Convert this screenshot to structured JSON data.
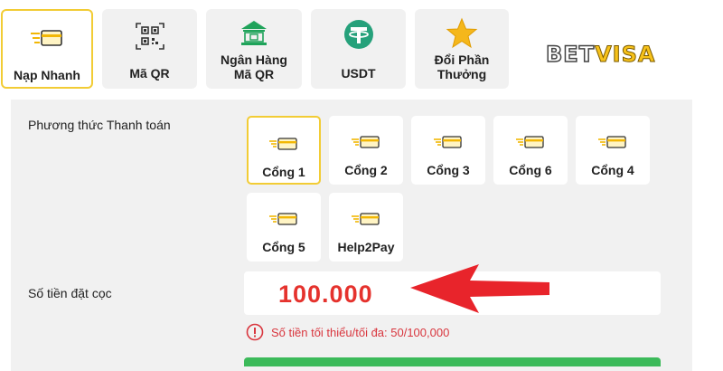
{
  "tabs": [
    {
      "label": "Nạp Nhanh",
      "icon": "card-icon",
      "active": true
    },
    {
      "label": "Mã QR",
      "icon": "qr-code-icon"
    },
    {
      "label_line1": "Ngân Hàng",
      "label_line2": "Mã QR",
      "icon": "bank-icon"
    },
    {
      "label": "USDT",
      "icon": "tether-icon"
    },
    {
      "label_line1": "Đổi Phần",
      "label_line2": "Thưởng",
      "icon": "star-icon"
    }
  ],
  "logo": {
    "part1": "BET",
    "part2": "VISA"
  },
  "payment": {
    "label": "Phương thức Thanh toán",
    "methods": [
      {
        "label": "Cổng 1",
        "selected": true
      },
      {
        "label": "Cổng 2"
      },
      {
        "label": "Cổng 3"
      },
      {
        "label": "Cổng 6"
      },
      {
        "label": "Cổng 4"
      },
      {
        "label": "Cổng 5"
      },
      {
        "label": "Help2Pay"
      }
    ]
  },
  "deposit": {
    "label": "Số tiền đặt cọc",
    "value": "100.000",
    "hint": "Số tiền tối thiểu/tối đa: 50/100,000"
  },
  "colors": {
    "accent_yellow": "#f2cc35",
    "amount_red": "#e5322d",
    "hint_red": "#d9363e",
    "tether_green": "#26a17b",
    "bank_green": "#1fa35a",
    "star_yellow": "#f5b71b",
    "confirm_green": "#3cba5a"
  }
}
